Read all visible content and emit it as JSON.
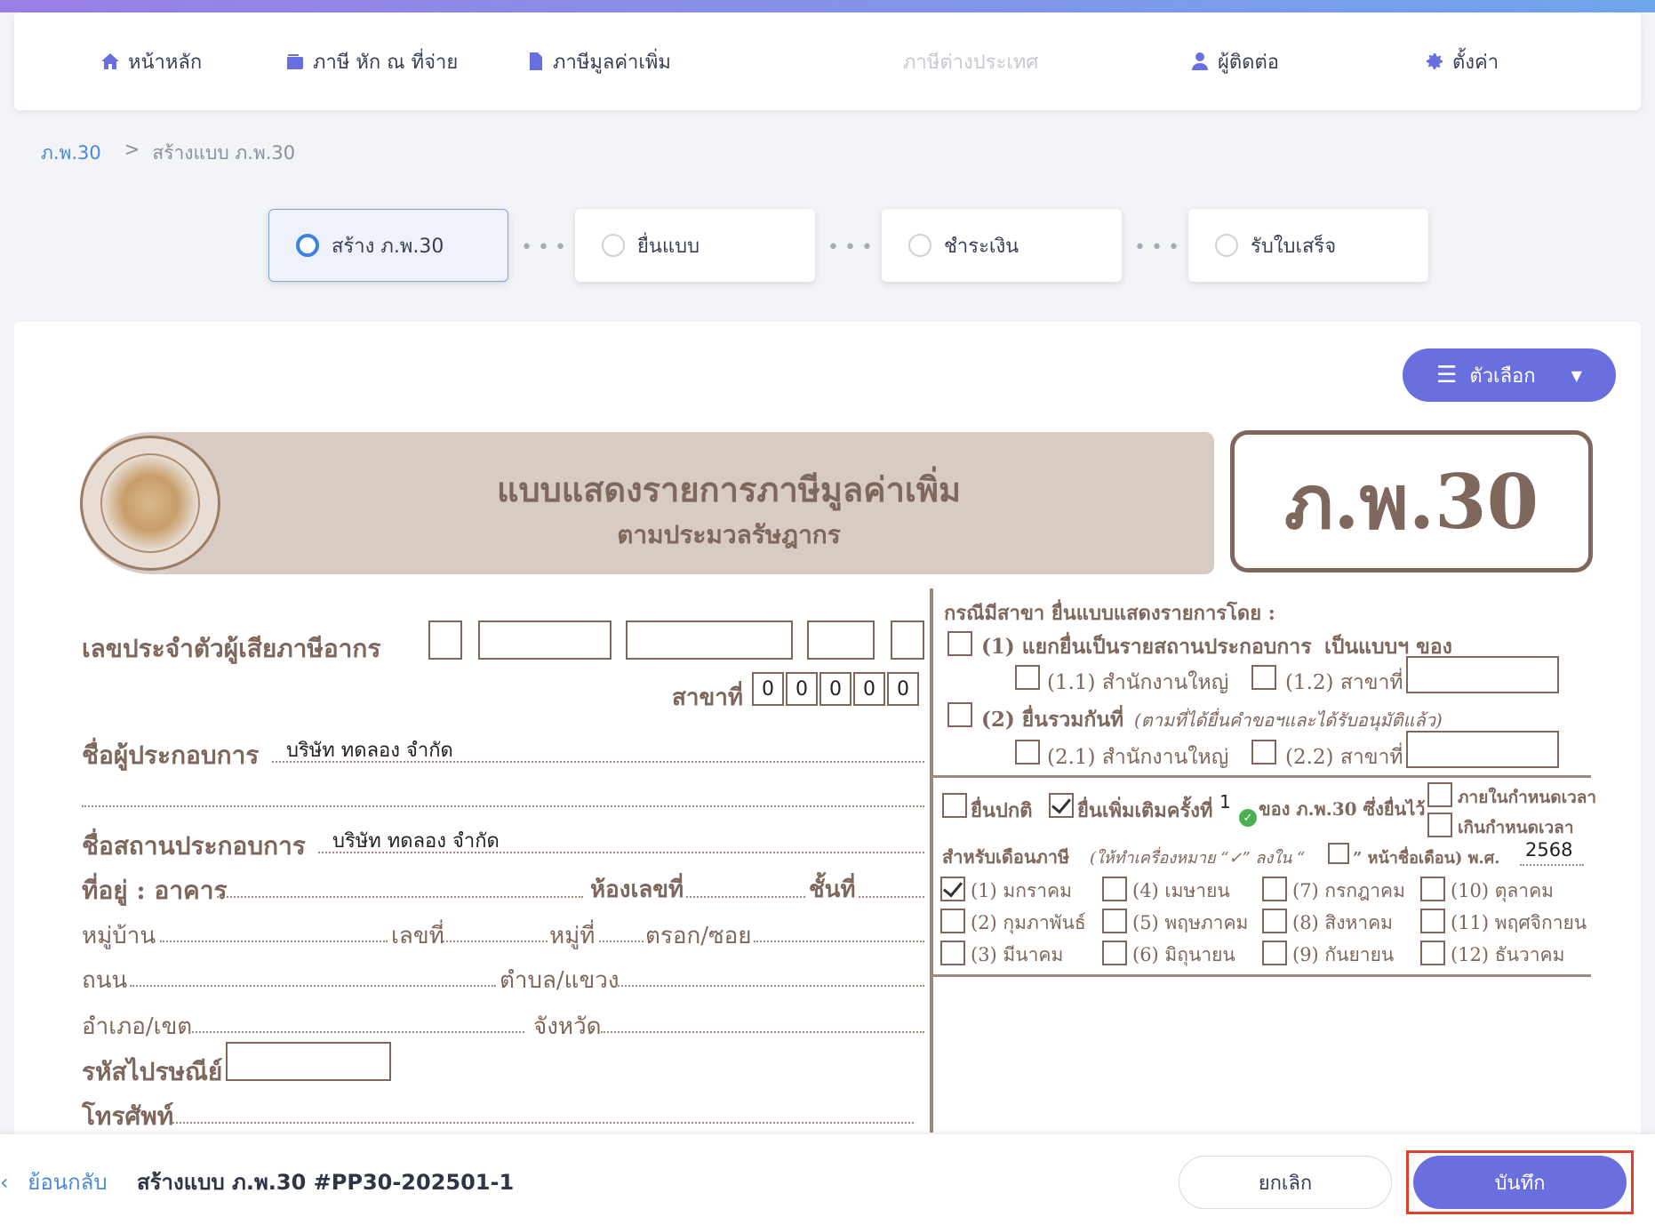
{
  "nav": {
    "items": [
      {
        "label": "หน้าหลัก",
        "icon": "home-icon"
      },
      {
        "label": "ภาษี หัก ณ ที่จ่าย",
        "icon": "wallet-icon"
      },
      {
        "label": "ภาษีมูลค่าเพิ่ม",
        "icon": "document-icon"
      },
      {
        "label": "ภาษีต่างประเทศ",
        "icon": ""
      },
      {
        "label": "ผู้ติดต่อ",
        "icon": "user-icon"
      },
      {
        "label": "ตั้งค่า",
        "icon": "gear-icon"
      }
    ]
  },
  "breadcrumb": {
    "root": "ภ.พ.30",
    "separator": ">",
    "current": "สร้างแบบ ภ.พ.30"
  },
  "steps": [
    {
      "label": "สร้าง ภ.พ.30",
      "active": true
    },
    {
      "label": "ยื่นแบบ",
      "active": false
    },
    {
      "label": "ชำระเงิน",
      "active": false
    },
    {
      "label": "รับใบเสร็จ",
      "active": false
    }
  ],
  "options_button": {
    "label": "ตัวเลือก"
  },
  "form": {
    "title": "แบบแสดงรายการภาษีมูลค่าเพิ่ม",
    "subtitle": "ตามประมวลรัษฎากร",
    "code": "ภ.พ.30",
    "tax_id_label": "เลขประจำตัวผู้เสียภาษีอากร",
    "branch_label": "สาขาที่",
    "branch_digits": [
      "0",
      "0",
      "0",
      "0",
      "0"
    ],
    "operator_label": "ชื่อผู้ประกอบการ",
    "operator_value": "บริษัท ทดลอง จำกัด",
    "establishment_label": "ชื่อสถานประกอบการ",
    "establishment_value": "บริษัท ทดลอง จำกัด",
    "address_label": "ที่อยู่ : อาคาร",
    "room_label": "ห้องเลขที่",
    "floor_label": "ชั้นที่",
    "village_label": "หมู่บ้าน",
    "number_label": "เลขที่",
    "moo_label": "หมู่ที่",
    "soi_label": "ตรอก/ซอย",
    "road_label": "ถนน",
    "subdistrict_label": "ตำบล/แขวง",
    "district_label": "อำเภอ/เขต",
    "province_label": "จังหวัด",
    "postal_label": "รหัสไปรษณีย์",
    "phone_label": "โทรศัพท์",
    "branch_case_label": "กรณีมีสาขา ยื่นแบบแสดงรายการโดย :",
    "opt1_label": "(1) แยกยื่นเป็นรายสถานประกอบการ",
    "opt1_suffix": "เป็นแบบฯ ของ",
    "opt11_label": "(1.1) สำนักงานใหญ่",
    "opt12_label": "(1.2) สาขาที่",
    "opt2_label": "(2) ยื่นรวมกันที่",
    "opt2_note": "(ตามที่ได้ยื่นคำขอฯและได้รับอนุมัติแล้ว)",
    "opt21_label": "(2.1) สำนักงานใหญ่",
    "opt22_label": "(2.2) สาขาที่",
    "normal_label": "ยื่นปกติ",
    "additional_label": "ยื่นเพิ่มเติมครั้งที่",
    "additional_value": "1",
    "of_label": "ของ ภ.พ.30 ซึ่งยื่นไว้",
    "within_label": "ภายในกำหนดเวลา",
    "over_label": "เกินกำหนดเวลา",
    "month_label": "สำหรับเดือนภาษี",
    "month_note": "(ให้ทำเครื่องหมาย “✓” ลงใน “",
    "month_note_end": "” หน้าชื่อเดือน) พ.ศ.",
    "year_value": "2568",
    "months": [
      {
        "label": "(1) มกราคม",
        "checked": true
      },
      {
        "label": "(2) กุมภาพันธ์",
        "checked": false
      },
      {
        "label": "(3) มีนาคม",
        "checked": false
      },
      {
        "label": "(4) เมษายน",
        "checked": false
      },
      {
        "label": "(5) พฤษภาคม",
        "checked": false
      },
      {
        "label": "(6) มิถุนายน",
        "checked": false
      },
      {
        "label": "(7) กรกฎาคม",
        "checked": false
      },
      {
        "label": "(8) สิงหาคม",
        "checked": false
      },
      {
        "label": "(9) กันยายน",
        "checked": false
      },
      {
        "label": "(10) ตุลาคม",
        "checked": false
      },
      {
        "label": "(11) พฤศจิกายน",
        "checked": false
      },
      {
        "label": "(12) ธันวาคม",
        "checked": false
      }
    ]
  },
  "footer": {
    "back_label": "ย้อนกลับ",
    "title": "สร้างแบบ ภ.พ.30 #PP30-202501-1",
    "cancel_label": "ยกเลิก",
    "save_label": "บันทึก"
  },
  "colors": {
    "accent": "#6a6fe0",
    "form_brown": "#7e675c",
    "link": "#4a8ad6",
    "highlight": "#e0412d"
  }
}
